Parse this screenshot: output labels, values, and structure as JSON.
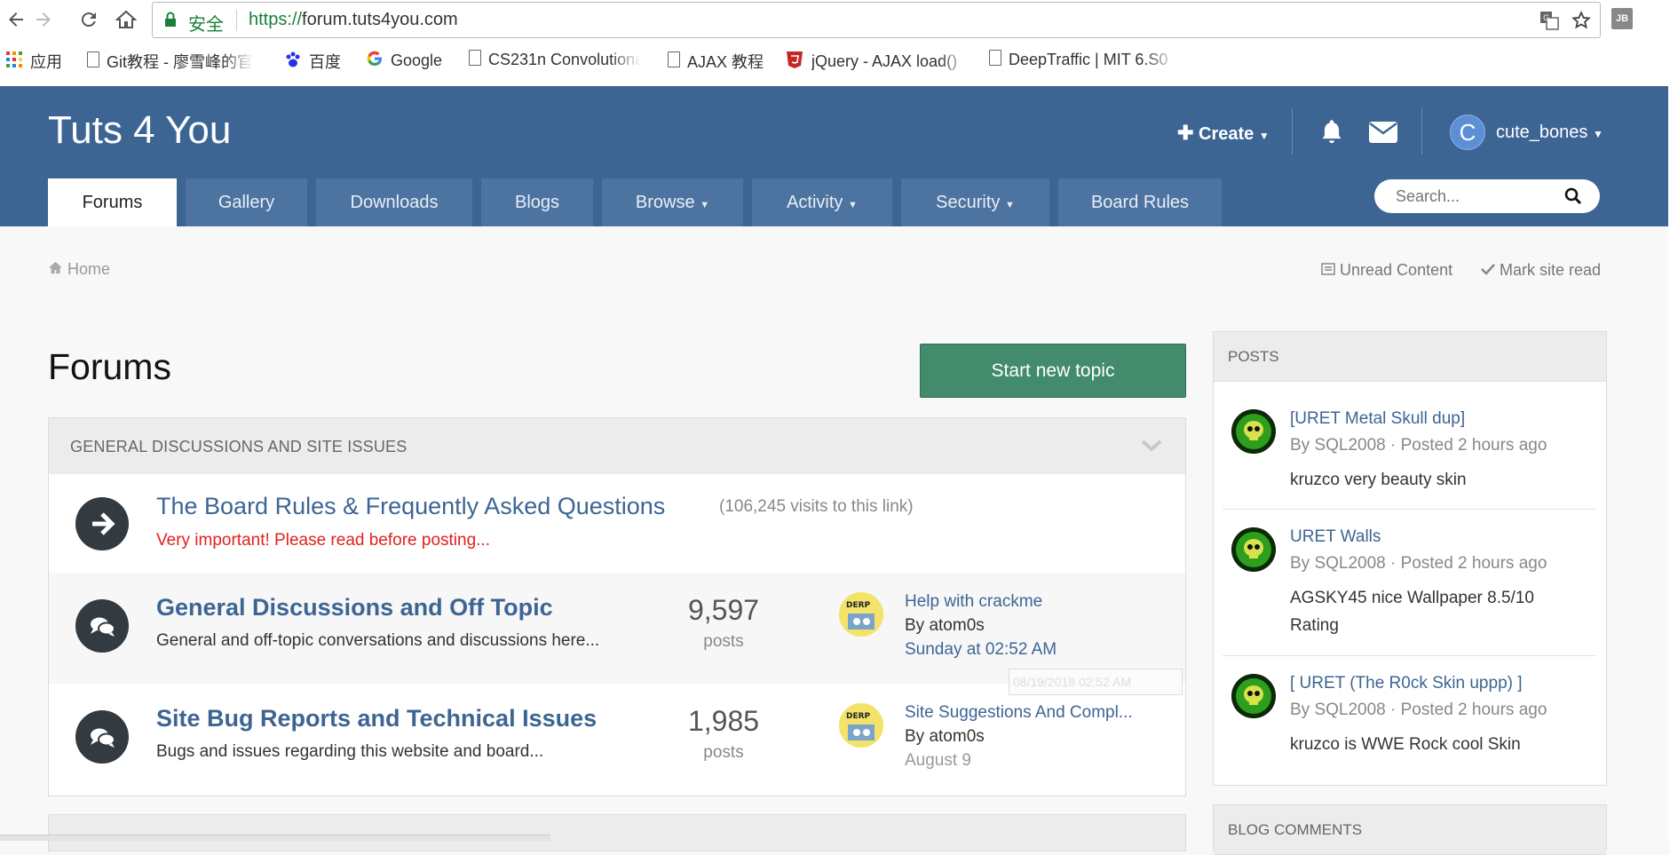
{
  "browser": {
    "security_label": "安全",
    "url_protocol": "https://",
    "url_rest": "forum.tuts4you.com",
    "extension_label": "JB",
    "bookmarks": [
      {
        "label": "应用",
        "icon": "apps-grid-icon"
      },
      {
        "label": "Git教程 - 廖雪峰的官",
        "icon": "page-icon"
      },
      {
        "label": "百度",
        "icon": "baidu-paw-icon"
      },
      {
        "label": "Google",
        "icon": "google-g-icon"
      },
      {
        "label": "CS231n Convolutiona",
        "icon": "page-icon"
      },
      {
        "label": "AJAX 教程",
        "icon": "page-icon"
      },
      {
        "label": "jQuery - AJAX load() ",
        "icon": "w3-shield-icon"
      },
      {
        "label": "DeepTraffic | MIT 6.S0",
        "icon": "page-icon"
      }
    ]
  },
  "site": {
    "title": "Tuts 4 You",
    "create_label": "Create",
    "username": "cute_bones",
    "avatar_letter": "C",
    "tabs": [
      {
        "label": "Forums",
        "active": true
      },
      {
        "label": "Gallery"
      },
      {
        "label": "Downloads"
      },
      {
        "label": "Blogs"
      },
      {
        "label": "Browse",
        "dropdown": true
      },
      {
        "label": "Activity",
        "dropdown": true
      },
      {
        "label": "Security",
        "dropdown": true
      },
      {
        "label": "Board Rules"
      }
    ],
    "search_placeholder": "Search..."
  },
  "breadcrumb": {
    "home": "Home"
  },
  "toplinks": {
    "unread": "Unread Content",
    "mark_read": "Mark site read"
  },
  "page": {
    "title": "Forums",
    "start_topic": "Start new topic"
  },
  "category": {
    "title": "GENERAL DISCUSSIONS AND SITE ISSUES",
    "rows": [
      {
        "title": "The Board Rules & Frequently Asked Questions",
        "visits": "(106,245 visits to this link)",
        "desc": "Very important! Please read before posting..."
      },
      {
        "title": "General Discussions and Off Topic",
        "desc": "General and off-topic conversations and discussions here...",
        "count": "9,597",
        "count_label": "posts",
        "last_title": "Help with crackme",
        "last_by": "By atom0s",
        "last_time": "Sunday at 02:52 AM"
      },
      {
        "title": "Site Bug Reports and Technical Issues",
        "desc": "Bugs and issues regarding this website and board...",
        "count": "1,985",
        "count_label": "posts",
        "last_title": "Site Suggestions And Compl...",
        "last_by": "By atom0s",
        "last_time": "August 9"
      }
    ],
    "tooltip": "08/19/2018 02:52  AM"
  },
  "avatar_text": "DERP",
  "sidebar": {
    "posts_title": "POSTS",
    "posts": [
      {
        "title": "[URET Metal Skull dup]",
        "meta": "By SQL2008 · Posted 2 hours ago",
        "body": "kruzco very beauty skin"
      },
      {
        "title": "URET Walls",
        "meta": "By SQL2008 · Posted 2 hours ago",
        "body": "AGSKY45 nice Wallpaper 8.5/10 Rating"
      },
      {
        "title": "[ URET (The R0ck Skin uppp) ]",
        "meta": "By SQL2008 · Posted 2 hours ago",
        "body": "kruzco is WWE Rock cool Skin"
      }
    ],
    "blog_title": "BLOG COMMENTS"
  },
  "colors": {
    "header": "#3d6594",
    "accent_green": "#428b6c",
    "link": "#3d6594",
    "alert_red": "#e0211d"
  }
}
